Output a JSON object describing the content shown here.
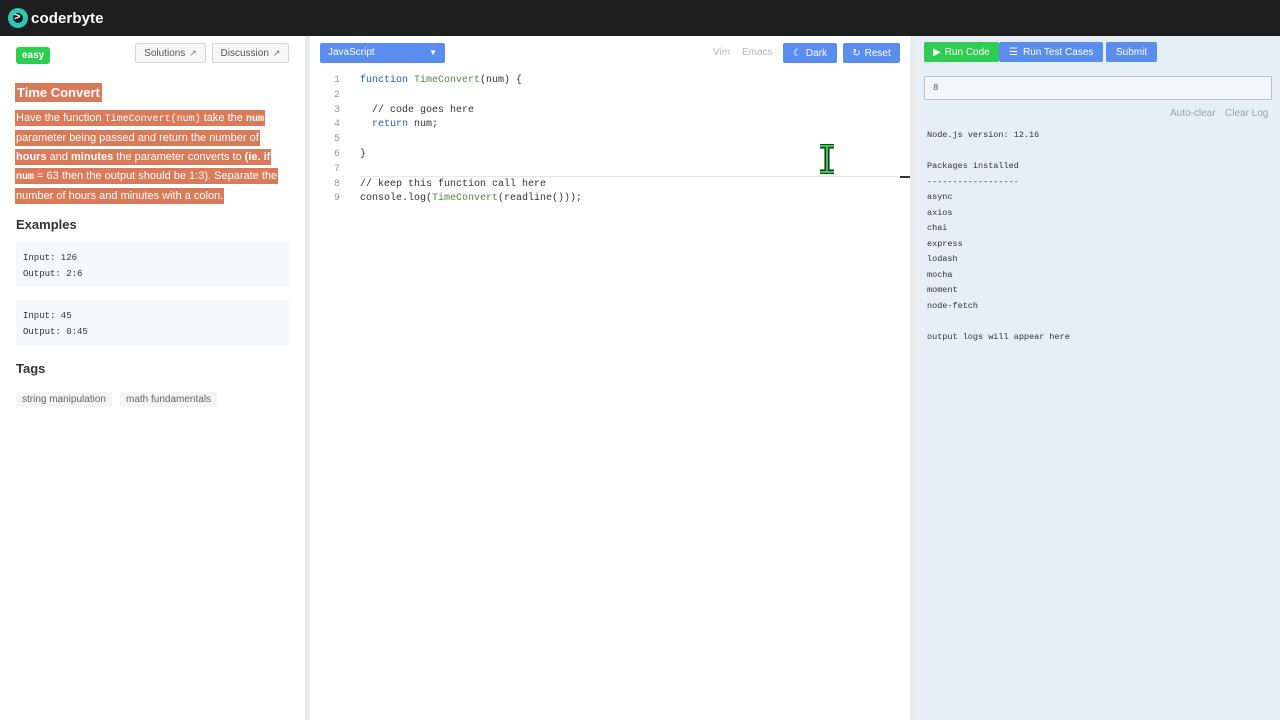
{
  "brand": {
    "name": "coderbyte",
    "logo_glyph": ">"
  },
  "problem": {
    "difficulty": "easy",
    "solutions_label": "Solutions",
    "discussion_label": "Discussion",
    "title": "Time Convert",
    "description": {
      "p1": "Have the function ",
      "code1": "TimeConvert(num)",
      "p2": " take the ",
      "code2": "num",
      "p3": " parameter being passed and return the number of ",
      "b1": "hours",
      "p4": " and ",
      "b2": "minutes",
      "p5": " the parameter converts to ",
      "b3": "(ie. if",
      "p6": " ",
      "code3": "num",
      "p7": " = 63 then the output should be 1:3). Separate the number of hours and minutes with a colon."
    },
    "examples_heading": "Examples",
    "examples": [
      {
        "input": "Input: 126",
        "output": "Output: 2:6"
      },
      {
        "input": "Input: 45",
        "output": "Output: 0:45"
      }
    ],
    "tags_heading": "Tags",
    "tags": [
      "string manipulation",
      "math fundamentals"
    ]
  },
  "editor": {
    "language": "JavaScript",
    "vim_label": "Vim",
    "emacs_label": "Emacs",
    "dark_label": "Dark",
    "reset_label": "Reset",
    "line_numbers": [
      "1",
      "2",
      "3",
      "4",
      "5",
      "6",
      "7",
      "8",
      "9"
    ],
    "code": {
      "l1_kw": "function ",
      "l1_fn": "TimeConvert",
      "l1_rest": "(num) {",
      "l3": "  // code goes here",
      "l4_kw": "  return",
      "l4_rest": " num;",
      "l6": "}",
      "l8": "// keep this function call here",
      "l9_a": "console.log(",
      "l9_fn": "TimeConvert",
      "l9_b": "(readline()));"
    }
  },
  "runner": {
    "run_code_label": "Run Code",
    "run_tests_label": "Run Test Cases",
    "submit_label": "Submit",
    "stdin_value": "8",
    "auto_clear_label": "Auto-clear",
    "clear_log_label": "Clear Log",
    "console_lines": [
      "Node.js version: 12.16",
      "",
      "Packages installed",
      "------------------",
      "async",
      "axios",
      "chai",
      "express",
      "lodash",
      "mocha",
      "moment",
      "node-fetch",
      "",
      "output logs will appear here"
    ]
  },
  "colors": {
    "accent_blue": "#5b8def",
    "success_green": "#2ecc52",
    "highlight": "#d97a5b",
    "topbar": "#1e1e1e"
  }
}
